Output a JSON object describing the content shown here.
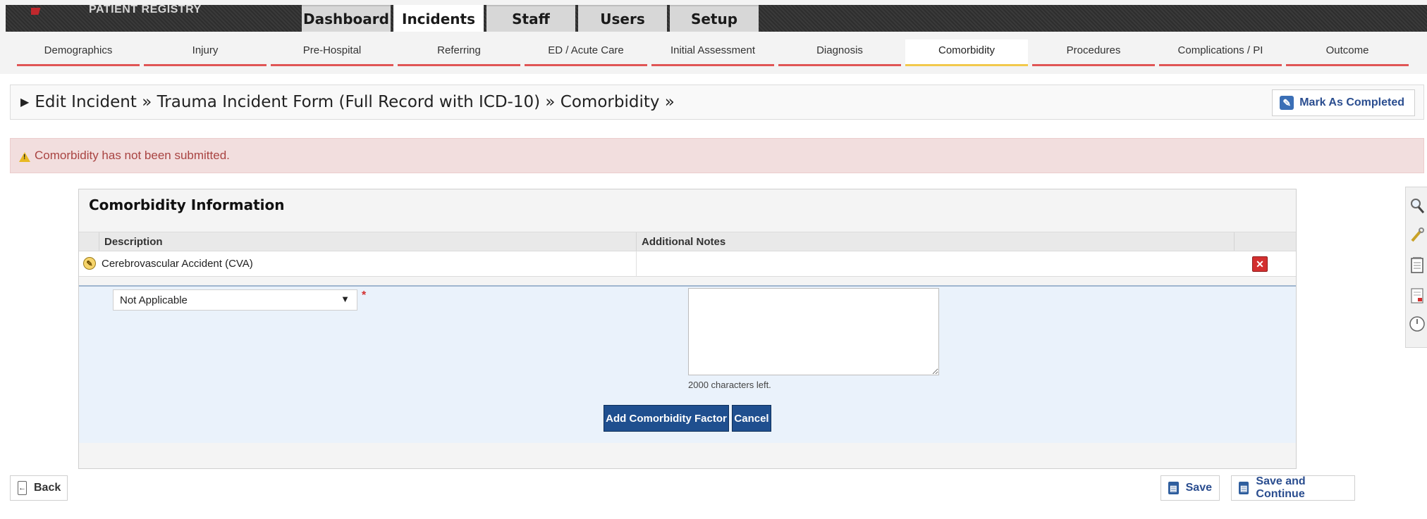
{
  "app": {
    "brand": "PATIENT REGISTRY"
  },
  "main_tabs": [
    {
      "label": "Dashboard",
      "active": false
    },
    {
      "label": "Incidents",
      "active": true
    },
    {
      "label": "Staff",
      "active": false
    },
    {
      "label": "Users",
      "active": false
    },
    {
      "label": "Setup",
      "active": false
    }
  ],
  "sub_tabs": [
    {
      "label": "Demographics",
      "active": false
    },
    {
      "label": "Injury",
      "active": false
    },
    {
      "label": "Pre-Hospital",
      "active": false
    },
    {
      "label": "Referring",
      "active": false
    },
    {
      "label": "ED / Acute Care",
      "active": false
    },
    {
      "label": "Initial Assessment",
      "active": false
    },
    {
      "label": "Diagnosis",
      "active": false
    },
    {
      "label": "Comorbidity",
      "active": true
    },
    {
      "label": "Procedures",
      "active": false
    },
    {
      "label": "Complications / PI",
      "active": false
    },
    {
      "label": "Outcome",
      "active": false
    }
  ],
  "breadcrumb": {
    "text": "Edit Incident » Trauma Incident Form (Full Record with ICD-10) » Comorbidity »"
  },
  "header_actions": {
    "mark_completed": "Mark As Completed"
  },
  "alert": {
    "text": "Comorbidity has not been submitted."
  },
  "panel": {
    "title": "Comorbidity Information",
    "columns": [
      "Description",
      "Additional Notes"
    ],
    "rows": [
      {
        "description": "Cerebrovascular Accident (CVA)",
        "notes": ""
      }
    ],
    "form": {
      "select_value": "Not Applicable",
      "required_mark": "*",
      "notes_value": "",
      "chars_left": "2000 characters left.",
      "add_label": "Add Comorbidity Factor",
      "cancel_label": "Cancel"
    }
  },
  "tools": [
    "search-icon",
    "wrench-icon",
    "notepad-icon",
    "document-icon",
    "clock-icon"
  ],
  "footer": {
    "back": "Back",
    "save": "Save",
    "save_continue": "Save and Continue"
  },
  "colors": {
    "topbar": "#333333",
    "subtab_underline": "#e05555",
    "active_subtab_underline": "#f2c94c",
    "alert_bg": "#f2dede",
    "alert_text": "#a94442",
    "primary_button": "#1f4f8f"
  }
}
